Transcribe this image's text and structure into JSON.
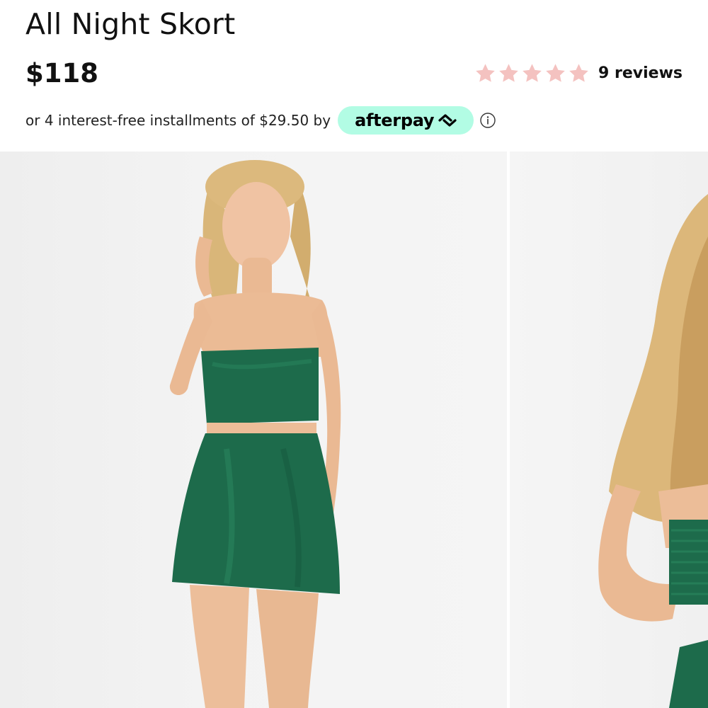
{
  "product": {
    "title": "All Night Skort",
    "price": "$118"
  },
  "rating": {
    "stars_filled": 5,
    "stars_total": 5,
    "star_color": "#f4c2c0",
    "reviews_label": "9 reviews"
  },
  "installments": {
    "text": "or 4 interest-free installments of $29.50 by",
    "provider": "afterpay",
    "provider_badge_color": "#b2fce4",
    "info_icon": "info-icon"
  },
  "gallery": {
    "images": [
      {
        "name": "model-front-photo",
        "garment_color": "#1d6b4b"
      },
      {
        "name": "model-back-photo",
        "garment_color": "#1d6b4b"
      }
    ]
  }
}
